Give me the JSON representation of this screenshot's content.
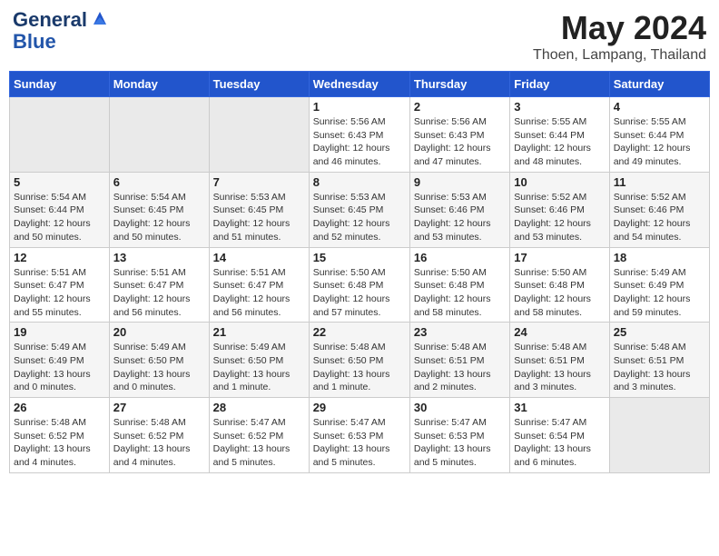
{
  "header": {
    "logo_line1": "General",
    "logo_line2": "Blue",
    "month": "May 2024",
    "location": "Thoen, Lampang, Thailand"
  },
  "days_of_week": [
    "Sunday",
    "Monday",
    "Tuesday",
    "Wednesday",
    "Thursday",
    "Friday",
    "Saturday"
  ],
  "weeks": [
    [
      {
        "day": "",
        "info": ""
      },
      {
        "day": "",
        "info": ""
      },
      {
        "day": "",
        "info": ""
      },
      {
        "day": "1",
        "info": "Sunrise: 5:56 AM\nSunset: 6:43 PM\nDaylight: 12 hours\nand 46 minutes."
      },
      {
        "day": "2",
        "info": "Sunrise: 5:56 AM\nSunset: 6:43 PM\nDaylight: 12 hours\nand 47 minutes."
      },
      {
        "day": "3",
        "info": "Sunrise: 5:55 AM\nSunset: 6:44 PM\nDaylight: 12 hours\nand 48 minutes."
      },
      {
        "day": "4",
        "info": "Sunrise: 5:55 AM\nSunset: 6:44 PM\nDaylight: 12 hours\nand 49 minutes."
      }
    ],
    [
      {
        "day": "5",
        "info": "Sunrise: 5:54 AM\nSunset: 6:44 PM\nDaylight: 12 hours\nand 50 minutes."
      },
      {
        "day": "6",
        "info": "Sunrise: 5:54 AM\nSunset: 6:45 PM\nDaylight: 12 hours\nand 50 minutes."
      },
      {
        "day": "7",
        "info": "Sunrise: 5:53 AM\nSunset: 6:45 PM\nDaylight: 12 hours\nand 51 minutes."
      },
      {
        "day": "8",
        "info": "Sunrise: 5:53 AM\nSunset: 6:45 PM\nDaylight: 12 hours\nand 52 minutes."
      },
      {
        "day": "9",
        "info": "Sunrise: 5:53 AM\nSunset: 6:46 PM\nDaylight: 12 hours\nand 53 minutes."
      },
      {
        "day": "10",
        "info": "Sunrise: 5:52 AM\nSunset: 6:46 PM\nDaylight: 12 hours\nand 53 minutes."
      },
      {
        "day": "11",
        "info": "Sunrise: 5:52 AM\nSunset: 6:46 PM\nDaylight: 12 hours\nand 54 minutes."
      }
    ],
    [
      {
        "day": "12",
        "info": "Sunrise: 5:51 AM\nSunset: 6:47 PM\nDaylight: 12 hours\nand 55 minutes."
      },
      {
        "day": "13",
        "info": "Sunrise: 5:51 AM\nSunset: 6:47 PM\nDaylight: 12 hours\nand 56 minutes."
      },
      {
        "day": "14",
        "info": "Sunrise: 5:51 AM\nSunset: 6:47 PM\nDaylight: 12 hours\nand 56 minutes."
      },
      {
        "day": "15",
        "info": "Sunrise: 5:50 AM\nSunset: 6:48 PM\nDaylight: 12 hours\nand 57 minutes."
      },
      {
        "day": "16",
        "info": "Sunrise: 5:50 AM\nSunset: 6:48 PM\nDaylight: 12 hours\nand 58 minutes."
      },
      {
        "day": "17",
        "info": "Sunrise: 5:50 AM\nSunset: 6:48 PM\nDaylight: 12 hours\nand 58 minutes."
      },
      {
        "day": "18",
        "info": "Sunrise: 5:49 AM\nSunset: 6:49 PM\nDaylight: 12 hours\nand 59 minutes."
      }
    ],
    [
      {
        "day": "19",
        "info": "Sunrise: 5:49 AM\nSunset: 6:49 PM\nDaylight: 13 hours\nand 0 minutes."
      },
      {
        "day": "20",
        "info": "Sunrise: 5:49 AM\nSunset: 6:50 PM\nDaylight: 13 hours\nand 0 minutes."
      },
      {
        "day": "21",
        "info": "Sunrise: 5:49 AM\nSunset: 6:50 PM\nDaylight: 13 hours\nand 1 minute."
      },
      {
        "day": "22",
        "info": "Sunrise: 5:48 AM\nSunset: 6:50 PM\nDaylight: 13 hours\nand 1 minute."
      },
      {
        "day": "23",
        "info": "Sunrise: 5:48 AM\nSunset: 6:51 PM\nDaylight: 13 hours\nand 2 minutes."
      },
      {
        "day": "24",
        "info": "Sunrise: 5:48 AM\nSunset: 6:51 PM\nDaylight: 13 hours\nand 3 minutes."
      },
      {
        "day": "25",
        "info": "Sunrise: 5:48 AM\nSunset: 6:51 PM\nDaylight: 13 hours\nand 3 minutes."
      }
    ],
    [
      {
        "day": "26",
        "info": "Sunrise: 5:48 AM\nSunset: 6:52 PM\nDaylight: 13 hours\nand 4 minutes."
      },
      {
        "day": "27",
        "info": "Sunrise: 5:48 AM\nSunset: 6:52 PM\nDaylight: 13 hours\nand 4 minutes."
      },
      {
        "day": "28",
        "info": "Sunrise: 5:47 AM\nSunset: 6:52 PM\nDaylight: 13 hours\nand 5 minutes."
      },
      {
        "day": "29",
        "info": "Sunrise: 5:47 AM\nSunset: 6:53 PM\nDaylight: 13 hours\nand 5 minutes."
      },
      {
        "day": "30",
        "info": "Sunrise: 5:47 AM\nSunset: 6:53 PM\nDaylight: 13 hours\nand 5 minutes."
      },
      {
        "day": "31",
        "info": "Sunrise: 5:47 AM\nSunset: 6:54 PM\nDaylight: 13 hours\nand 6 minutes."
      },
      {
        "day": "",
        "info": ""
      }
    ]
  ]
}
